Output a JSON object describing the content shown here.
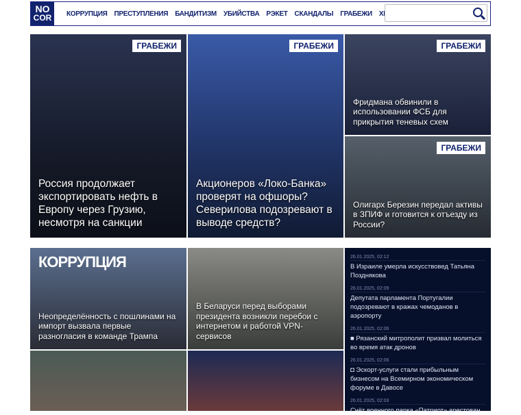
{
  "header": {
    "logo_top": "NO",
    "logo_bottom": "COR",
    "nav": [
      "КОРРУПЦИЯ",
      "ПРЕСТУПЛЕНИЯ",
      "БАНДИТИЗМ",
      "УБИЙСТВА",
      "РЭКЕТ",
      "СКАНДАЛЫ",
      "ГРАБЕЖИ",
      "ХРОНИКА"
    ],
    "search_placeholder": ""
  },
  "top": [
    {
      "badge": "ГРАБЕЖИ",
      "title": "Россия продолжает экспортировать нефть в Европу через Грузию, несмотря на санкции"
    },
    {
      "badge": "ГРАБЕЖИ",
      "title": "Акционеров «Локо-Банка» проверят на офшоры? Северилова подозревают в выводе средств?"
    },
    {
      "badge": "ГРАБЕЖИ",
      "title": "Фридмана обвинили в использовании ФСБ для прикрытия теневых схем"
    },
    {
      "badge": "ГРАБЕЖИ",
      "title": "Олигарх Березин передал активы в ЗПИФ и готовится к отъезду из России?"
    }
  ],
  "section": {
    "title": "КОРРУПЦИЯ"
  },
  "mid": [
    {
      "title": "Неопределённость с пошлинами на импорт вызвала первые разногласия в команде Трампа"
    },
    {
      "title": "В Беларуси перед выборами президента возникли перебои с интернетом и работой VPN-сервисов"
    }
  ],
  "news": [
    {
      "date": "26.01.2025, 02:12",
      "title": "В Израиле умерла искусствовед Татьяна Позднякова",
      "icon": ""
    },
    {
      "date": "26.01.2025, 02:09",
      "title": "Депутата парламента Португалии подозревают в кражах чемоданов в аэропорту",
      "icon": ""
    },
    {
      "date": "26.01.2025, 02:06",
      "title": "Рязанский митрополит призвал молиться во время атак дронов",
      "icon": "■"
    },
    {
      "date": "26.01.2025, 02:06",
      "title": "Эскорт-услуги стали прибыльным бизнесом на Всемирном экономическом форуме в Давосе",
      "icon": "◘"
    },
    {
      "date": "26.01.2025, 02:03",
      "title": "Счёт военного парка «Патриот» арестован",
      "icon": ""
    }
  ]
}
